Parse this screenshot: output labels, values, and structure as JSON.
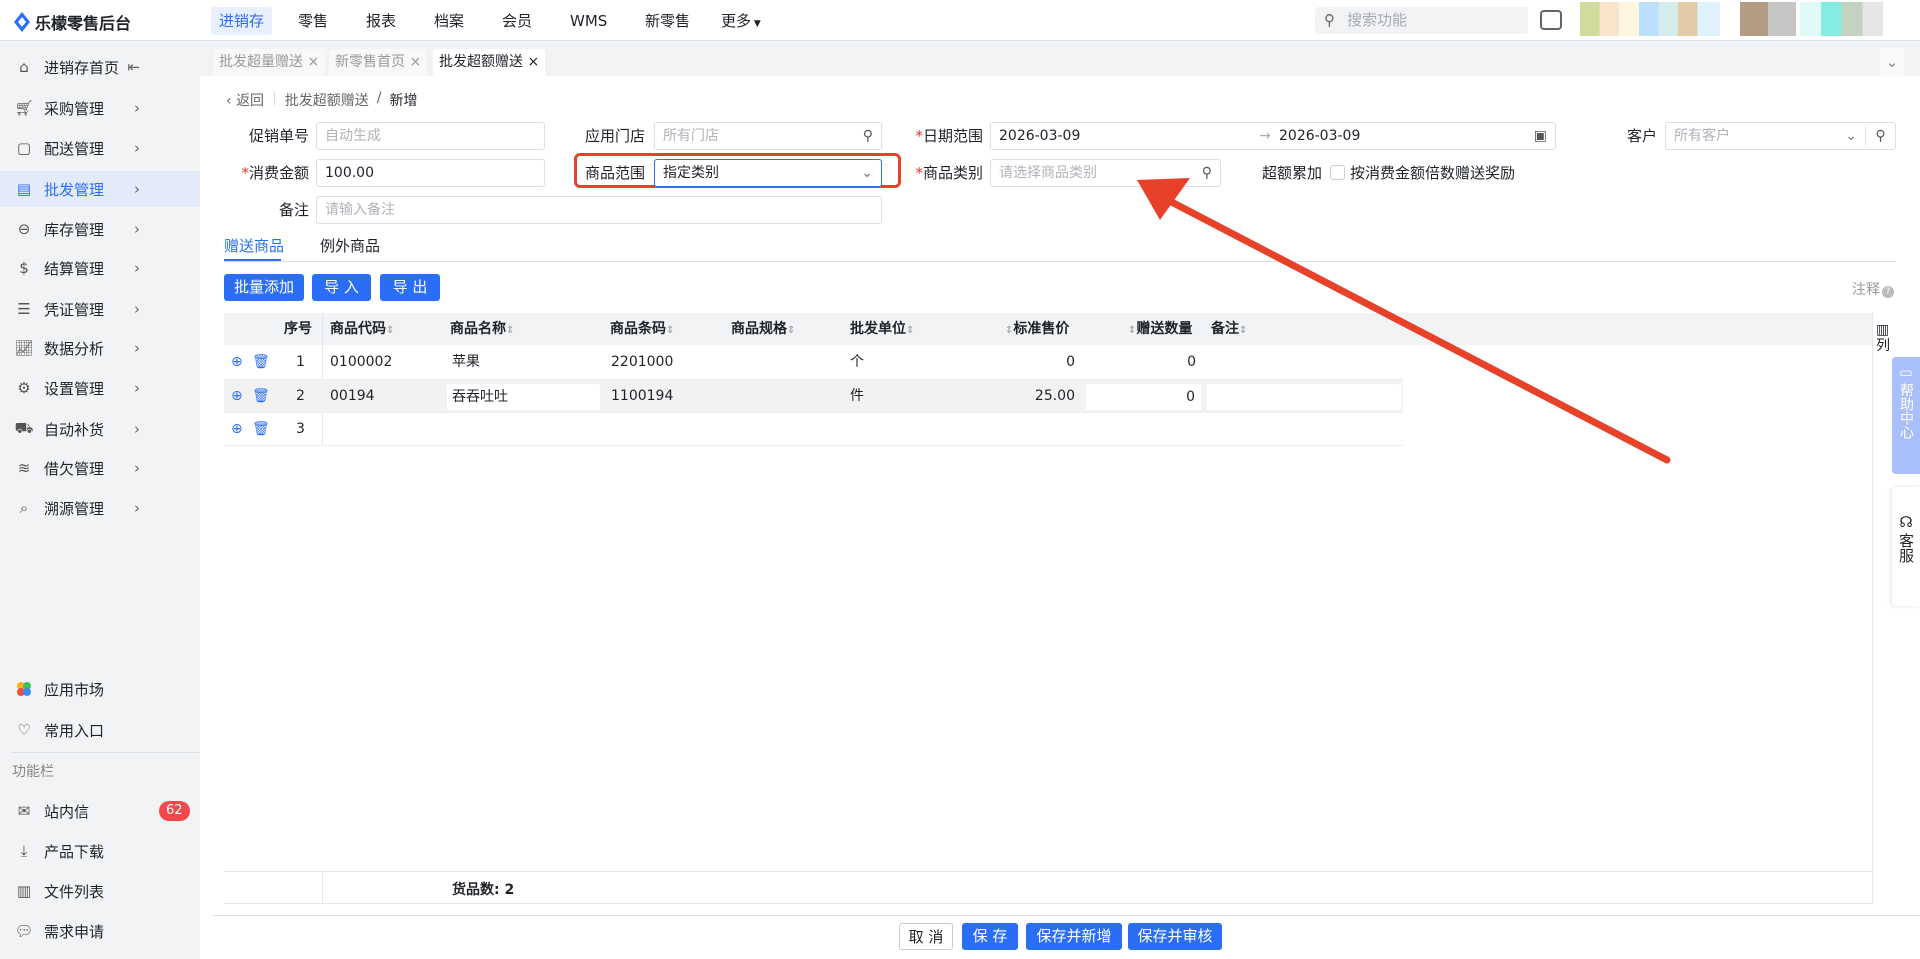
{
  "app": {
    "title": "乐檬零售后台"
  },
  "topnav": [
    {
      "label": "进销存",
      "active": true
    },
    {
      "label": "零售"
    },
    {
      "label": "报表"
    },
    {
      "label": "档案"
    },
    {
      "label": "会员"
    },
    {
      "label": "WMS"
    },
    {
      "label": "新零售"
    },
    {
      "label": "更多"
    }
  ],
  "search": {
    "placeholder": "搜索功能"
  },
  "sidebar": {
    "items": [
      {
        "label": "进销存首页"
      },
      {
        "label": "采购管理"
      },
      {
        "label": "配送管理"
      },
      {
        "label": "批发管理",
        "active": true
      },
      {
        "label": "库存管理"
      },
      {
        "label": "结算管理"
      },
      {
        "label": "凭证管理"
      },
      {
        "label": "数据分析"
      },
      {
        "label": "设置管理"
      },
      {
        "label": "自动补货"
      },
      {
        "label": "借欠管理"
      },
      {
        "label": "溯源管理"
      }
    ],
    "market": "应用市场",
    "favorites": "常用入口",
    "section": "功能栏",
    "messages": "站内信",
    "messages_badge": "62",
    "download": "产品下载",
    "files": "文件列表",
    "requests": "需求申请"
  },
  "tabs": [
    {
      "label": "批发超量赠送"
    },
    {
      "label": "新零售首页"
    },
    {
      "label": "批发超额赠送",
      "active": true
    }
  ],
  "breadcrumb": {
    "back": "返回",
    "parent": "批发超额赠送",
    "current": "新增"
  },
  "form": {
    "promo_no": {
      "label": "促销单号",
      "placeholder": "自动生成"
    },
    "store": {
      "label": "应用门店",
      "placeholder": "所有门店"
    },
    "date": {
      "label": "日期范围",
      "start": "2026-03-09",
      "end": "2026-03-09"
    },
    "customer": {
      "label": "客户",
      "placeholder": "所有客户"
    },
    "amount": {
      "label": "消费金额",
      "value": "100.00"
    },
    "scope": {
      "label": "商品范围",
      "value": "指定类别"
    },
    "category": {
      "label": "商品类别",
      "placeholder": "请选择商品类别"
    },
    "accumulate": {
      "label": "超额累加",
      "option": "按消费金额倍数赠送奖励",
      "checked": false
    },
    "remark": {
      "label": "备注",
      "placeholder": "请输入备注"
    }
  },
  "subtabs": [
    {
      "label": "赠送商品",
      "active": true
    },
    {
      "label": "例外商品"
    }
  ],
  "toolbar": {
    "batch_add": "批量添加",
    "import": "导 入",
    "export": "导 出",
    "notes": "注释"
  },
  "table": {
    "columns": [
      "序号",
      "商品代码",
      "商品名称",
      "商品条码",
      "商品规格",
      "批发单位",
      "标准售价",
      "赠送数量",
      "备注"
    ],
    "rows": [
      {
        "no": "1",
        "code": "0100002",
        "name": "苹果",
        "barcode": "2201000",
        "spec": "",
        "unit": "个",
        "price": "0",
        "qty": "0",
        "remark": ""
      },
      {
        "no": "2",
        "code": "00194",
        "name": "吞吞吐吐",
        "barcode": "1100194",
        "spec": "",
        "unit": "件",
        "price": "25.00",
        "qty": "0",
        "remark": ""
      },
      {
        "no": "3",
        "code": "",
        "name": "",
        "barcode": "",
        "spec": "",
        "unit": "",
        "price": "",
        "qty": "",
        "remark": ""
      }
    ],
    "footer": "货品数: 2",
    "columns_btn": "列"
  },
  "actions": {
    "cancel": "取 消",
    "save": "保 存",
    "save_new": "保存并新增",
    "save_audit": "保存并审核"
  },
  "float": {
    "help": "帮助中心",
    "service": "客服"
  },
  "colors": {
    "accent": "#2b6ef6",
    "annotation": "#e8412a",
    "badge": "#f5484d"
  }
}
